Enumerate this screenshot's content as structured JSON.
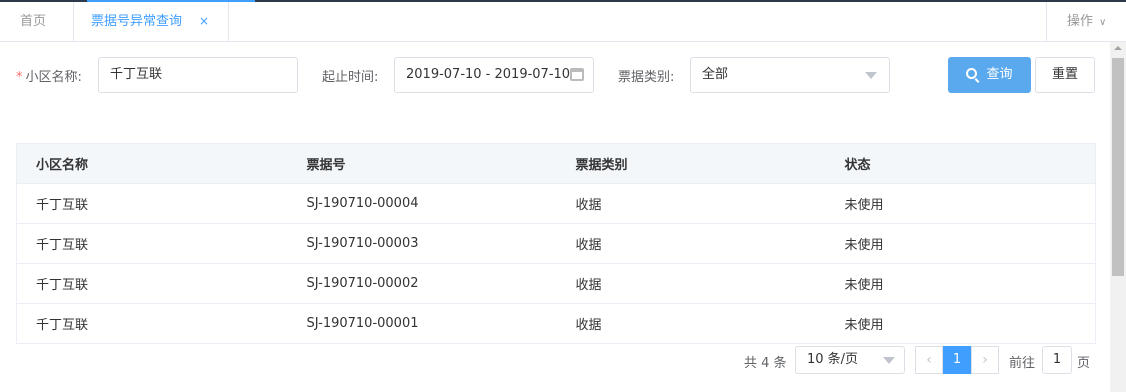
{
  "tabs": [
    {
      "label": "首页"
    },
    {
      "label": "票据号异常查询",
      "close": "×"
    }
  ],
  "ops": {
    "label": "操作",
    "chevron": "∨"
  },
  "filters": {
    "community_label": "小区名称:",
    "required_mark": "*",
    "community_value": "千丁互联",
    "date_label": "起止时间:",
    "date_value": "2019-07-10 - 2019-07-10",
    "type_label": "票据类别:",
    "type_value": "全部",
    "search_label": "查询",
    "reset_label": "重置"
  },
  "table": {
    "headers": [
      "小区名称",
      "票据号",
      "票据类别",
      "状态"
    ],
    "rows": [
      [
        "千丁互联",
        "SJ-190710-00004",
        "收据",
        "未使用"
      ],
      [
        "千丁互联",
        "SJ-190710-00003",
        "收据",
        "未使用"
      ],
      [
        "千丁互联",
        "SJ-190710-00002",
        "收据",
        "未使用"
      ],
      [
        "千丁互联",
        "SJ-190710-00001",
        "收据",
        "未使用"
      ]
    ]
  },
  "pagination": {
    "total": "共 4 条",
    "page_size": "10 条/页",
    "prev": "‹",
    "current": "1",
    "next": "›",
    "goto_label": "前往",
    "goto_value": "1",
    "page_suffix": "页"
  },
  "colors": {
    "accent": "#409eff",
    "button": "#5aa9ee",
    "required": "#f56c6c"
  }
}
